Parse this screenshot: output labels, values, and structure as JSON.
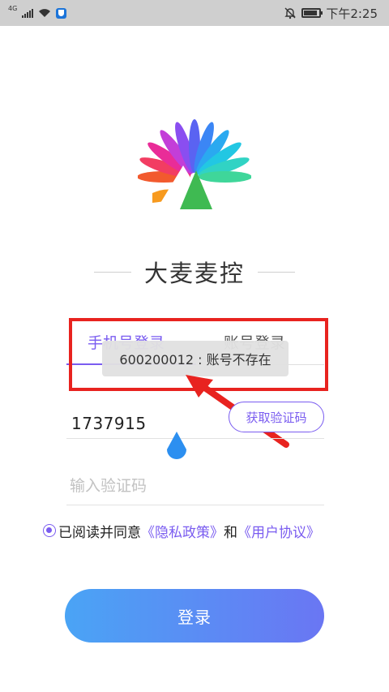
{
  "status_bar": {
    "network": "4G",
    "time": "下午2:25"
  },
  "app": {
    "title": "大麦麦控"
  },
  "tabs": {
    "phone_login": "手机号登录",
    "account_login": "账号登录"
  },
  "toast": {
    "message": "600200012 : 账号不存在"
  },
  "form": {
    "phone_value": "1737915",
    "get_code_label": "获取验证码",
    "code_placeholder": "输入验证码"
  },
  "agreement": {
    "prefix": "已阅读并同意",
    "privacy_link": "《隐私政策》",
    "and": "和",
    "user_link": "《用户协议》"
  },
  "login_button": {
    "label": "登录"
  },
  "colors": {
    "accent": "#7a5cf0",
    "highlight_red": "#e8231f",
    "button_gradient_start": "#4aa4f5",
    "button_gradient_end": "#6a76f3"
  },
  "icons": [
    "signal-icon",
    "wifi-icon",
    "shield-app-icon",
    "bell-off-icon",
    "battery-icon",
    "radio-checked-icon",
    "text-cursor-handle-icon",
    "red-arrow-annotation"
  ]
}
